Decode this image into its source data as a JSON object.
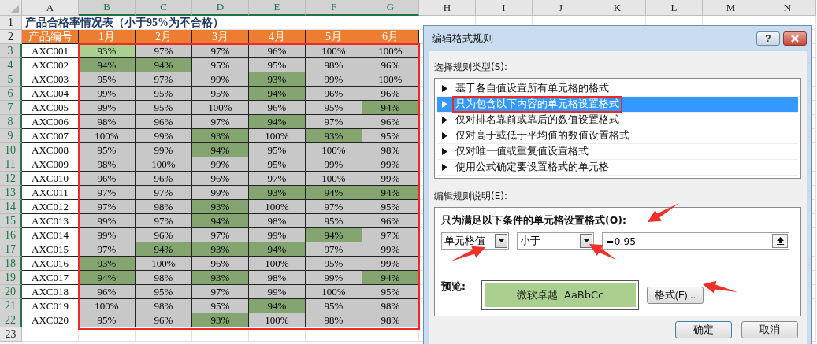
{
  "sheet": {
    "column_letters": [
      {
        "label": "A",
        "selected": false
      },
      {
        "label": "B",
        "selected": true
      },
      {
        "label": "C",
        "selected": true
      },
      {
        "label": "D",
        "selected": true
      },
      {
        "label": "E",
        "selected": true
      },
      {
        "label": "F",
        "selected": true
      },
      {
        "label": "G",
        "selected": true
      },
      {
        "label": "H",
        "selected": false
      },
      {
        "label": "I",
        "selected": false
      },
      {
        "label": "J",
        "selected": false
      },
      {
        "label": "K",
        "selected": false
      },
      {
        "label": "L",
        "selected": false
      },
      {
        "label": "M",
        "selected": false
      },
      {
        "label": "N",
        "selected": false
      }
    ],
    "row_numbers": [
      {
        "label": "1",
        "selected": false
      },
      {
        "label": "2",
        "selected": false
      },
      {
        "label": "3",
        "selected": true
      },
      {
        "label": "4",
        "selected": true
      },
      {
        "label": "5",
        "selected": true
      },
      {
        "label": "6",
        "selected": true
      },
      {
        "label": "7",
        "selected": true
      },
      {
        "label": "8",
        "selected": true
      },
      {
        "label": "9",
        "selected": true
      },
      {
        "label": "10",
        "selected": true
      },
      {
        "label": "11",
        "selected": true
      },
      {
        "label": "12",
        "selected": true
      },
      {
        "label": "13",
        "selected": true
      },
      {
        "label": "14",
        "selected": true
      },
      {
        "label": "15",
        "selected": true
      },
      {
        "label": "16",
        "selected": true
      },
      {
        "label": "17",
        "selected": true
      },
      {
        "label": "18",
        "selected": true
      },
      {
        "label": "19",
        "selected": true
      },
      {
        "label": "20",
        "selected": true
      },
      {
        "label": "21",
        "selected": true
      },
      {
        "label": "22",
        "selected": true
      },
      {
        "label": "23",
        "selected": false
      }
    ],
    "title": "产品合格率情况表（小于95%为不合格）",
    "headers": [
      "产品编号",
      "1月",
      "2月",
      "3月",
      "4月",
      "5月",
      "6月"
    ],
    "rows": [
      {
        "id": "AXC001",
        "cells": [
          {
            "text": "93%",
            "highlighted": true,
            "selected": true
          },
          {
            "text": "97%",
            "highlighted": false,
            "selected": false
          },
          {
            "text": "97%",
            "highlighted": false,
            "selected": false
          },
          {
            "text": "96%",
            "highlighted": false,
            "selected": false
          },
          {
            "text": "100%",
            "highlighted": false,
            "selected": false
          },
          {
            "text": "100%",
            "highlighted": false,
            "selected": false
          }
        ]
      },
      {
        "id": "AXC002",
        "cells": [
          {
            "text": "94%",
            "highlighted": true,
            "selected": false
          },
          {
            "text": "94%",
            "highlighted": true,
            "selected": false
          },
          {
            "text": "95%",
            "highlighted": false,
            "selected": false
          },
          {
            "text": "95%",
            "highlighted": false,
            "selected": false
          },
          {
            "text": "98%",
            "highlighted": false,
            "selected": false
          },
          {
            "text": "96%",
            "highlighted": false,
            "selected": false
          }
        ]
      },
      {
        "id": "AXC003",
        "cells": [
          {
            "text": "95%",
            "highlighted": false,
            "selected": false
          },
          {
            "text": "97%",
            "highlighted": false,
            "selected": false
          },
          {
            "text": "99%",
            "highlighted": false,
            "selected": false
          },
          {
            "text": "93%",
            "highlighted": true,
            "selected": false
          },
          {
            "text": "99%",
            "highlighted": false,
            "selected": false
          },
          {
            "text": "100%",
            "highlighted": false,
            "selected": false
          }
        ]
      },
      {
        "id": "AXC004",
        "cells": [
          {
            "text": "99%",
            "highlighted": false,
            "selected": false
          },
          {
            "text": "95%",
            "highlighted": false,
            "selected": false
          },
          {
            "text": "95%",
            "highlighted": false,
            "selected": false
          },
          {
            "text": "94%",
            "highlighted": true,
            "selected": false
          },
          {
            "text": "96%",
            "highlighted": false,
            "selected": false
          },
          {
            "text": "96%",
            "highlighted": false,
            "selected": false
          }
        ]
      },
      {
        "id": "AXC005",
        "cells": [
          {
            "text": "99%",
            "highlighted": false,
            "selected": false
          },
          {
            "text": "95%",
            "highlighted": false,
            "selected": false
          },
          {
            "text": "100%",
            "highlighted": false,
            "selected": false
          },
          {
            "text": "96%",
            "highlighted": false,
            "selected": false
          },
          {
            "text": "95%",
            "highlighted": false,
            "selected": false
          },
          {
            "text": "94%",
            "highlighted": true,
            "selected": false
          }
        ]
      },
      {
        "id": "AXC006",
        "cells": [
          {
            "text": "98%",
            "highlighted": false,
            "selected": false
          },
          {
            "text": "96%",
            "highlighted": false,
            "selected": false
          },
          {
            "text": "97%",
            "highlighted": false,
            "selected": false
          },
          {
            "text": "94%",
            "highlighted": true,
            "selected": false
          },
          {
            "text": "97%",
            "highlighted": false,
            "selected": false
          },
          {
            "text": "96%",
            "highlighted": false,
            "selected": false
          }
        ]
      },
      {
        "id": "AXC007",
        "cells": [
          {
            "text": "100%",
            "highlighted": false,
            "selected": false
          },
          {
            "text": "99%",
            "highlighted": false,
            "selected": false
          },
          {
            "text": "93%",
            "highlighted": true,
            "selected": false
          },
          {
            "text": "100%",
            "highlighted": false,
            "selected": false
          },
          {
            "text": "93%",
            "highlighted": true,
            "selected": false
          },
          {
            "text": "95%",
            "highlighted": false,
            "selected": false
          }
        ]
      },
      {
        "id": "AXC008",
        "cells": [
          {
            "text": "95%",
            "highlighted": false,
            "selected": false
          },
          {
            "text": "99%",
            "highlighted": false,
            "selected": false
          },
          {
            "text": "94%",
            "highlighted": true,
            "selected": false
          },
          {
            "text": "95%",
            "highlighted": false,
            "selected": false
          },
          {
            "text": "100%",
            "highlighted": false,
            "selected": false
          },
          {
            "text": "98%",
            "highlighted": false,
            "selected": false
          }
        ]
      },
      {
        "id": "AXC009",
        "cells": [
          {
            "text": "98%",
            "highlighted": false,
            "selected": false
          },
          {
            "text": "100%",
            "highlighted": false,
            "selected": false
          },
          {
            "text": "99%",
            "highlighted": false,
            "selected": false
          },
          {
            "text": "95%",
            "highlighted": false,
            "selected": false
          },
          {
            "text": "99%",
            "highlighted": false,
            "selected": false
          },
          {
            "text": "99%",
            "highlighted": false,
            "selected": false
          }
        ]
      },
      {
        "id": "AXC010",
        "cells": [
          {
            "text": "96%",
            "highlighted": false,
            "selected": false
          },
          {
            "text": "96%",
            "highlighted": false,
            "selected": false
          },
          {
            "text": "96%",
            "highlighted": false,
            "selected": false
          },
          {
            "text": "97%",
            "highlighted": false,
            "selected": false
          },
          {
            "text": "100%",
            "highlighted": false,
            "selected": false
          },
          {
            "text": "99%",
            "highlighted": false,
            "selected": false
          }
        ]
      },
      {
        "id": "AXC011",
        "cells": [
          {
            "text": "97%",
            "highlighted": false,
            "selected": false
          },
          {
            "text": "97%",
            "highlighted": false,
            "selected": false
          },
          {
            "text": "99%",
            "highlighted": false,
            "selected": false
          },
          {
            "text": "93%",
            "highlighted": true,
            "selected": false
          },
          {
            "text": "94%",
            "highlighted": true,
            "selected": false
          },
          {
            "text": "94%",
            "highlighted": true,
            "selected": false
          }
        ]
      },
      {
        "id": "AXC012",
        "cells": [
          {
            "text": "97%",
            "highlighted": false,
            "selected": false
          },
          {
            "text": "98%",
            "highlighted": false,
            "selected": false
          },
          {
            "text": "93%",
            "highlighted": true,
            "selected": false
          },
          {
            "text": "100%",
            "highlighted": false,
            "selected": false
          },
          {
            "text": "97%",
            "highlighted": false,
            "selected": false
          },
          {
            "text": "95%",
            "highlighted": false,
            "selected": false
          }
        ]
      },
      {
        "id": "AXC013",
        "cells": [
          {
            "text": "99%",
            "highlighted": false,
            "selected": false
          },
          {
            "text": "97%",
            "highlighted": false,
            "selected": false
          },
          {
            "text": "94%",
            "highlighted": true,
            "selected": false
          },
          {
            "text": "98%",
            "highlighted": false,
            "selected": false
          },
          {
            "text": "95%",
            "highlighted": false,
            "selected": false
          },
          {
            "text": "96%",
            "highlighted": false,
            "selected": false
          }
        ]
      },
      {
        "id": "AXC014",
        "cells": [
          {
            "text": "99%",
            "highlighted": false,
            "selected": false
          },
          {
            "text": "96%",
            "highlighted": false,
            "selected": false
          },
          {
            "text": "97%",
            "highlighted": false,
            "selected": false
          },
          {
            "text": "99%",
            "highlighted": false,
            "selected": false
          },
          {
            "text": "94%",
            "highlighted": true,
            "selected": false
          },
          {
            "text": "97%",
            "highlighted": false,
            "selected": false
          }
        ]
      },
      {
        "id": "AXC015",
        "cells": [
          {
            "text": "97%",
            "highlighted": false,
            "selected": false
          },
          {
            "text": "94%",
            "highlighted": true,
            "selected": false
          },
          {
            "text": "93%",
            "highlighted": true,
            "selected": false
          },
          {
            "text": "94%",
            "highlighted": true,
            "selected": false
          },
          {
            "text": "97%",
            "highlighted": false,
            "selected": false
          },
          {
            "text": "99%",
            "highlighted": false,
            "selected": false
          }
        ]
      },
      {
        "id": "AXC016",
        "cells": [
          {
            "text": "93%",
            "highlighted": true,
            "selected": false
          },
          {
            "text": "100%",
            "highlighted": false,
            "selected": false
          },
          {
            "text": "96%",
            "highlighted": false,
            "selected": false
          },
          {
            "text": "100%",
            "highlighted": false,
            "selected": false
          },
          {
            "text": "95%",
            "highlighted": false,
            "selected": false
          },
          {
            "text": "99%",
            "highlighted": false,
            "selected": false
          }
        ]
      },
      {
        "id": "AXC017",
        "cells": [
          {
            "text": "94%",
            "highlighted": true,
            "selected": false
          },
          {
            "text": "98%",
            "highlighted": false,
            "selected": false
          },
          {
            "text": "93%",
            "highlighted": true,
            "selected": false
          },
          {
            "text": "98%",
            "highlighted": false,
            "selected": false
          },
          {
            "text": "99%",
            "highlighted": false,
            "selected": false
          },
          {
            "text": "94%",
            "highlighted": true,
            "selected": false
          }
        ]
      },
      {
        "id": "AXC018",
        "cells": [
          {
            "text": "96%",
            "highlighted": false,
            "selected": false
          },
          {
            "text": "95%",
            "highlighted": false,
            "selected": false
          },
          {
            "text": "97%",
            "highlighted": false,
            "selected": false
          },
          {
            "text": "99%",
            "highlighted": false,
            "selected": false
          },
          {
            "text": "100%",
            "highlighted": false,
            "selected": false
          },
          {
            "text": "95%",
            "highlighted": false,
            "selected": false
          }
        ]
      },
      {
        "id": "AXC019",
        "cells": [
          {
            "text": "100%",
            "highlighted": false,
            "selected": false
          },
          {
            "text": "98%",
            "highlighted": false,
            "selected": false
          },
          {
            "text": "95%",
            "highlighted": false,
            "selected": false
          },
          {
            "text": "94%",
            "highlighted": true,
            "selected": false
          },
          {
            "text": "95%",
            "highlighted": false,
            "selected": false
          },
          {
            "text": "98%",
            "highlighted": false,
            "selected": false
          }
        ]
      },
      {
        "id": "AXC020",
        "cells": [
          {
            "text": "95%",
            "highlighted": false,
            "selected": false
          },
          {
            "text": "96%",
            "highlighted": false,
            "selected": false
          },
          {
            "text": "93%",
            "highlighted": true,
            "selected": false
          },
          {
            "text": "100%",
            "highlighted": false,
            "selected": false
          },
          {
            "text": "98%",
            "highlighted": false,
            "selected": false
          },
          {
            "text": "98%",
            "highlighted": false,
            "selected": false
          }
        ]
      }
    ]
  },
  "dialog": {
    "title": "编辑格式规则",
    "help_button": "?",
    "rule_type_label": "选择规则类型(S):",
    "rule_types": [
      {
        "label": "基于各自值设置所有单元格的格式",
        "selected": false,
        "annotated": false
      },
      {
        "label": "只为包含以下内容的单元格设置格式",
        "selected": true,
        "annotated": true
      },
      {
        "label": "仅对排名靠前或靠后的数值设置格式",
        "selected": false,
        "annotated": false
      },
      {
        "label": "仅对高于或低于平均值的数值设置格式",
        "selected": false,
        "annotated": false
      },
      {
        "label": "仅对唯一值或重复值设置格式",
        "selected": false,
        "annotated": false
      },
      {
        "label": "使用公式确定要设置格式的单元格",
        "selected": false,
        "annotated": false
      }
    ],
    "description_label": "编辑规则说明(E):",
    "condition_label": "只为满足以下条件的单元格设置格式(O):",
    "condition_field": "单元格值",
    "operator": "小于",
    "value": "=0.95",
    "preview_label": "预览:",
    "preview_text": "微软卓越  AaBbCc",
    "format_button": "格式(F)...",
    "ok_button": "确定",
    "cancel_button": "取消"
  }
}
